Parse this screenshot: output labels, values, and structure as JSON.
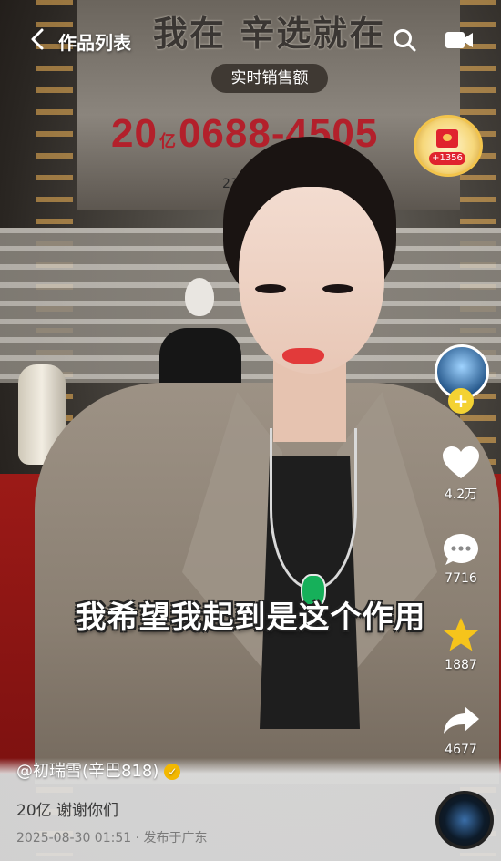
{
  "header": {
    "back_label": "",
    "title": "作品列表"
  },
  "stage": {
    "slogan": "我在 辛选就在",
    "sales_label": "实时销售额",
    "sales_prefix": "20",
    "sales_unit": "亿",
    "sales_digits": "0688-4505",
    "sales_sub": "23"
  },
  "red_packet": {
    "badge": "+1356"
  },
  "actions": {
    "likes": "4.2万",
    "comments": "7716",
    "favorites": "1887",
    "shares": "4677"
  },
  "caption": "我希望我起到是这个作用",
  "post": {
    "author": "@初瑞雪(辛巴818)",
    "description": "20亿 谢谢你们",
    "meta": "2025-08-30 01:51 · 发布于广东"
  },
  "colors": {
    "sales_red": "#b3202b",
    "follow_yellow": "#f4d233",
    "like_white": "#ffffff",
    "favorite_gold": "#f6c41b"
  }
}
